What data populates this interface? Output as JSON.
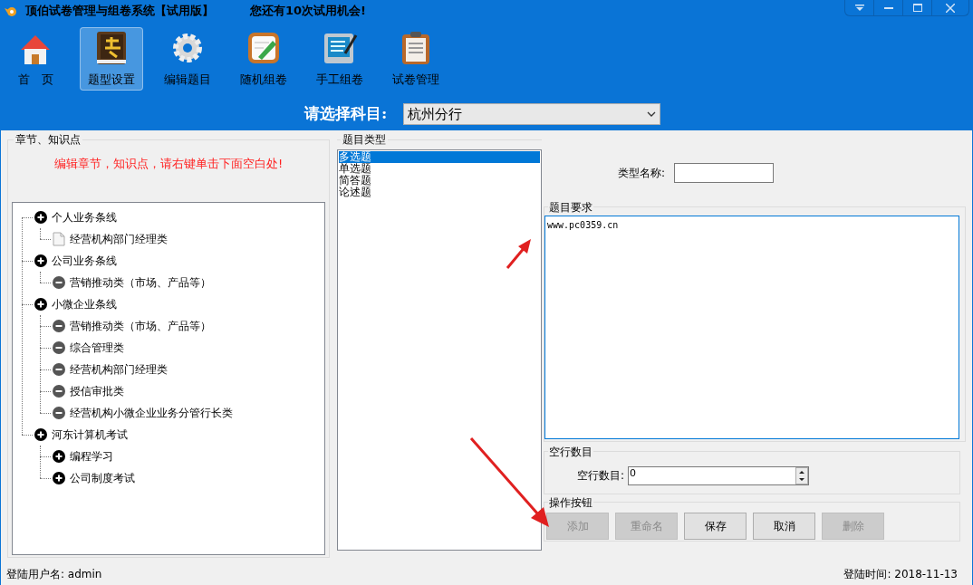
{
  "window": {
    "title": "顶伯试卷管理与组卷系统【试用版】",
    "notice": "您还有10次试用机会!"
  },
  "toolbar": [
    {
      "label": "首　页",
      "kind": "home",
      "selected": false
    },
    {
      "label": "题型设置",
      "kind": "book",
      "selected": true
    },
    {
      "label": "编辑题目",
      "kind": "gear",
      "selected": false
    },
    {
      "label": "随机组卷",
      "kind": "pencil",
      "selected": false
    },
    {
      "label": "手工组卷",
      "kind": "notebook",
      "selected": false
    },
    {
      "label": "试卷管理",
      "kind": "clipboard",
      "selected": false
    }
  ],
  "subject": {
    "label": "请选择科目:",
    "value": "杭州分行"
  },
  "chapters": {
    "title": "章节、知识点",
    "hint": "编辑章节，知识点，请右键单击下面空白处!",
    "tree": [
      {
        "label": "个人业务条线",
        "kind": "plus",
        "children": [
          {
            "label": "经营机构部门经理类",
            "kind": "doc"
          }
        ]
      },
      {
        "label": "公司业务条线",
        "kind": "plus",
        "children": [
          {
            "label": "营销推动类（市场、产品等）",
            "kind": "minus"
          }
        ]
      },
      {
        "label": "小微企业条线",
        "kind": "plus",
        "children": [
          {
            "label": "营销推动类（市场、产品等）",
            "kind": "minus"
          },
          {
            "label": "综合管理类",
            "kind": "minus"
          },
          {
            "label": "经营机构部门经理类",
            "kind": "minus"
          },
          {
            "label": "授信审批类",
            "kind": "minus"
          },
          {
            "label": "经营机构小微企业业务分管行长类",
            "kind": "minus"
          }
        ]
      },
      {
        "label": "河东计算机考试",
        "kind": "plus",
        "children": [
          {
            "label": "编程学习",
            "kind": "plus"
          },
          {
            "label": "公司制度考试",
            "kind": "plus"
          }
        ]
      }
    ]
  },
  "question_types": {
    "title": "题目类型",
    "items": [
      {
        "label": "多选题",
        "selected": true
      },
      {
        "label": "单选题",
        "selected": false
      },
      {
        "label": "简答题",
        "selected": false
      },
      {
        "label": "论述题",
        "selected": false
      }
    ]
  },
  "type_name": {
    "label": "类型名称:"
  },
  "requirements": {
    "title": "题目要求",
    "value": "www.pc0359.cn"
  },
  "blank_lines": {
    "title": "空行数目",
    "label": "空行数目:",
    "value": "0"
  },
  "actions": {
    "title": "操作按钮",
    "buttons": [
      {
        "label": "添加",
        "disabled": true
      },
      {
        "label": "重命名",
        "disabled": true
      },
      {
        "label": "保存",
        "disabled": false
      },
      {
        "label": "取消",
        "disabled": false
      },
      {
        "label": "删除",
        "disabled": true
      }
    ]
  },
  "status_bar": {
    "user_label": "登陆用户名:",
    "user": "admin",
    "time_label": "登陆时间:",
    "time": "2018-11-13"
  }
}
